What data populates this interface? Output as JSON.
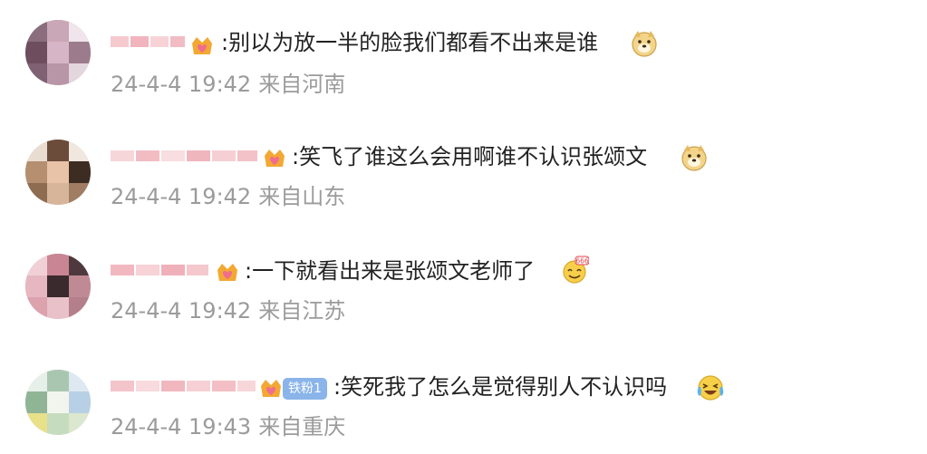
{
  "colors": {
    "text": "#222222",
    "meta": "#9b9b9b",
    "fans_tag_bg": "#8ab4ea",
    "badge_gold": "#f3a833",
    "badge_pink": "#ef6d8e"
  },
  "comments": [
    {
      "username_hidden": true,
      "badge_icon": "crown-heart-badge-icon",
      "text": ":别以为放一半的脸我们都看不出来是谁",
      "emoji": "doge-emoji-icon",
      "time": "24-4-4 19:42",
      "location": "来自河南"
    },
    {
      "username_hidden": true,
      "badge_icon": "crown-heart-badge-icon",
      "text": ":笑飞了谁这么会用啊谁不认识张颂文",
      "emoji": "doge-emoji-icon",
      "time": "24-4-4 19:42",
      "location": "来自山东"
    },
    {
      "username_hidden": true,
      "badge_icon": "crown-heart-badge-icon",
      "text": ":一下就看出来是张颂文老师了",
      "emoji": "666-emoji-icon",
      "time": "24-4-4 19:42",
      "location": "来自江苏"
    },
    {
      "username_hidden": true,
      "badge_icon": "crown-heart-badge-icon",
      "fans_tag": "铁粉1",
      "text": ":笑死我了怎么是觉得别人不认识吗",
      "emoji": "laugh-cry-emoji-icon",
      "time": "24-4-4 19:43",
      "location": "来自重庆"
    }
  ]
}
